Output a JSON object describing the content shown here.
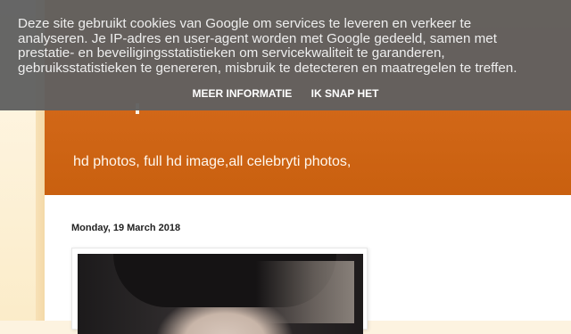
{
  "cookie_notice": {
    "text_lines": [
      "Deze site gebruikt cookies van Google om services te leveren en verkeer te",
      "analyseren. Je IP-adres en user-agent worden met Google gedeeld, samen met",
      "prestatie- en beveiligingsstatistieken om servicekwaliteit te garanderen,",
      "gebruiksstatistieken te genereren, misbruik te detecteren en maatregelen te treffen."
    ],
    "more_info_label": "MEER INFORMATIE",
    "accept_label": "IK SNAP HET"
  },
  "header": {
    "description": "hd photos, full hd image,all celebryti photos,"
  },
  "post": {
    "date": "Monday, 19 March 2018"
  },
  "colors": {
    "header_orange": "#d4691a",
    "cookie_bar": "#606060",
    "page_bg": "#fdf3e0"
  }
}
